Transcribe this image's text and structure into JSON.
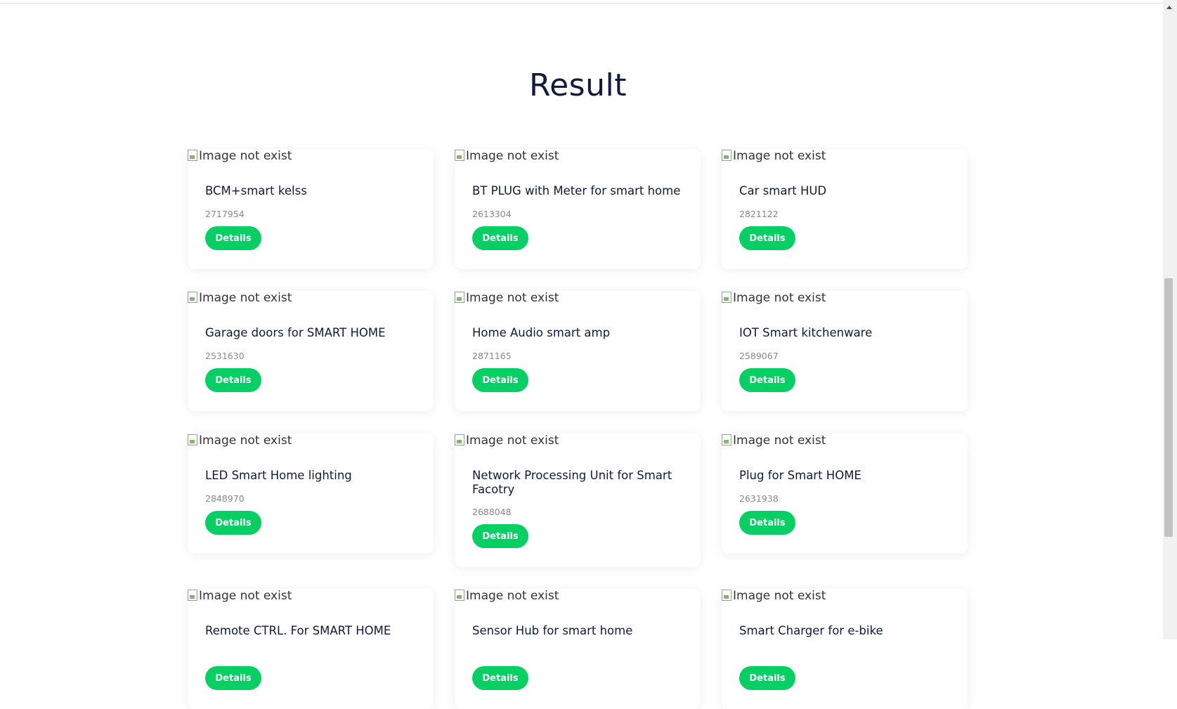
{
  "page": {
    "title": "Result"
  },
  "image_alt": "Image not exist",
  "details_label": "Details",
  "colors": {
    "accent": "#06cf64",
    "heading": "#0d1b3e",
    "code": "#888888"
  },
  "products": [
    {
      "name": "BCM+smart kelss",
      "code": "2717954"
    },
    {
      "name": "BT PLUG with Meter for smart home",
      "code": "2613304"
    },
    {
      "name": "Car smart HUD",
      "code": "2821122"
    },
    {
      "name": "Garage doors for SMART HOME",
      "code": "2531630"
    },
    {
      "name": "Home Audio smart amp",
      "code": "2871165"
    },
    {
      "name": "IOT Smart kitchenware",
      "code": "2589067"
    },
    {
      "name": "LED Smart Home lighting",
      "code": "2848970"
    },
    {
      "name": "Network Processing Unit for Smart Facotry",
      "code": "2688048"
    },
    {
      "name": "Plug for Smart HOME",
      "code": "2631938"
    },
    {
      "name": "Remote CTRL. For SMART HOME",
      "code": ""
    },
    {
      "name": "Sensor Hub for smart home",
      "code": ""
    },
    {
      "name": "Smart Charger for e-bike",
      "code": ""
    }
  ]
}
